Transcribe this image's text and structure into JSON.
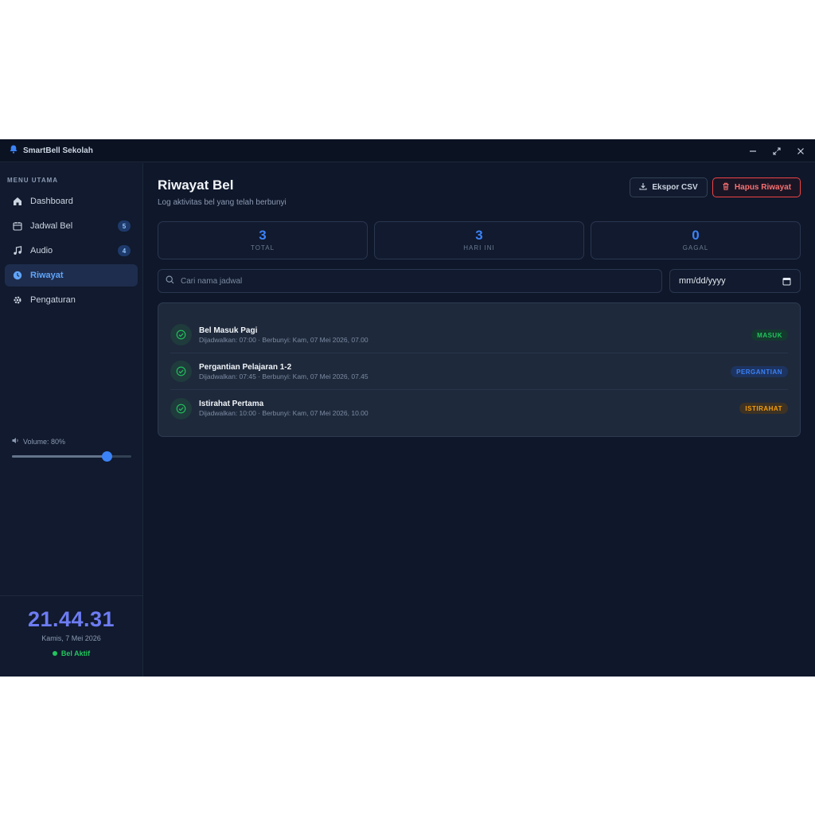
{
  "app": {
    "title": "SmartBell Sekolah",
    "accent": "#3b82f6"
  },
  "window_controls": [
    "minimize-icon",
    "maximize-icon",
    "close-icon"
  ],
  "sidebar": {
    "menu_title": "MENU UTAMA",
    "items": [
      {
        "label": "Dashboard",
        "icon": "home-icon",
        "badge": null,
        "active": false
      },
      {
        "label": "Jadwal Bel",
        "icon": "calendar-icon",
        "badge": "5",
        "active": false
      },
      {
        "label": "Audio",
        "icon": "music-note-icon",
        "badge": "4",
        "active": false
      },
      {
        "label": "Riwayat",
        "icon": "clock-icon",
        "badge": null,
        "active": true
      },
      {
        "label": "Pengaturan",
        "icon": "gear-icon",
        "badge": null,
        "active": false
      }
    ],
    "volume_label": "Volume: 80%",
    "volume_level": 0.8,
    "clock": {
      "time": "21.44.31",
      "date": "Kamis, 7 Mei 2026",
      "status": "Bel Aktif",
      "status_color": "#22c55e"
    }
  },
  "main": {
    "title": "Riwayat Bel",
    "subtitle": "Log aktivitas bel yang telah berbunyi",
    "export_label": "Ekspor CSV",
    "delete_label": "Hapus Riwayat",
    "stats": [
      {
        "value": "3",
        "label": "TOTAL"
      },
      {
        "value": "3",
        "label": "HARI INI"
      },
      {
        "value": "0",
        "label": "GAGAL"
      }
    ],
    "search_placeholder": "Cari nama jadwal",
    "date_placeholder": "mm/dd/yyyy",
    "history": [
      {
        "name": "Bel Masuk Pagi",
        "meta": "Dijadwalkan: 07:00 · Berbunyi: Kam, 07 Mei 2026, 07.00",
        "tag": "MASUK",
        "tag_color": "#22c55e",
        "tag_bg": "#14392e"
      },
      {
        "name": "Pergantian Pelajaran 1-2",
        "meta": "Dijadwalkan: 07:45 · Berbunyi: Kam, 07 Mei 2026, 07.45",
        "tag": "PERGANTIAN",
        "tag_color": "#3b82f6",
        "tag_bg": "#1d3461"
      },
      {
        "name": "Istirahat Pertama",
        "meta": "Dijadwalkan: 10:00 · Berbunyi: Kam, 07 Mei 2026, 10.00",
        "tag": "ISTIRAHAT",
        "tag_color": "#f59e0b",
        "tag_bg": "#3d3223"
      }
    ]
  }
}
